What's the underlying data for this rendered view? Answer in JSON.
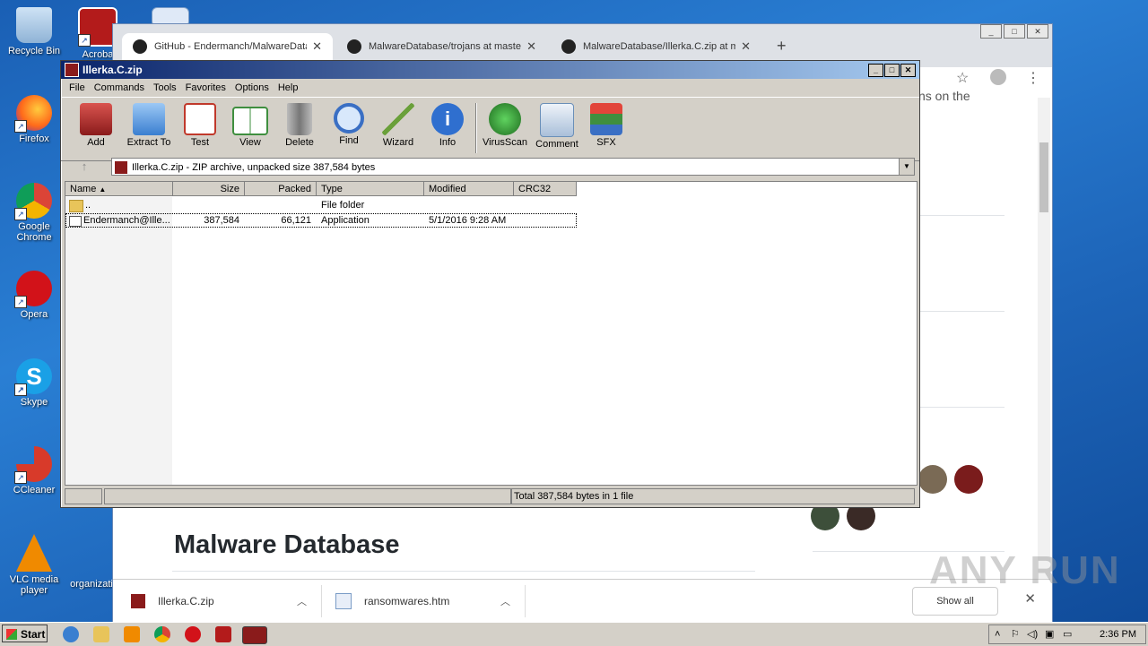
{
  "desktop": {
    "icons": [
      {
        "label": "Recycle Bin",
        "icon": "recycle-bin-icon"
      },
      {
        "label": "Firefox",
        "icon": "firefox-icon"
      },
      {
        "label": "Google Chrome",
        "icon": "chrome-icon"
      },
      {
        "label": "Opera",
        "icon": "opera-icon"
      },
      {
        "label": "Skype",
        "icon": "skype-icon"
      },
      {
        "label": "CCleaner",
        "icon": "ccleaner-icon"
      },
      {
        "label": "VLC media player",
        "icon": "vlc-icon"
      },
      {
        "label": "Acroba",
        "icon": "acrobat-icon"
      },
      {
        "label": "organizati",
        "icon": "word-doc-icon"
      }
    ]
  },
  "chrome": {
    "tabs": [
      {
        "title": "GitHub - Endermanch/MalwareDatab",
        "close": "✕"
      },
      {
        "title": "MalwareDatabase/trojans at master",
        "close": "✕"
      },
      {
        "title": "MalwareDatabase/Illerka.C.zip at ma",
        "close": "✕"
      }
    ],
    "new_tab": "+",
    "page_heading": "Malware Database",
    "right_snippet": "ns on the",
    "downloads": [
      {
        "name": "Illerka.C.zip",
        "icon": "winrar-icon"
      },
      {
        "name": "ransomwares.htm",
        "icon": "html-file-icon"
      }
    ],
    "show_all": "Show all"
  },
  "winrar": {
    "title": "Illerka.C.zip",
    "menu": [
      "File",
      "Commands",
      "Tools",
      "Favorites",
      "Options",
      "Help"
    ],
    "toolbar": [
      {
        "label": "Add",
        "icon": "add-archive-icon",
        "color": "#b5332e"
      },
      {
        "label": "Extract To",
        "icon": "extract-folder-icon",
        "color": "#4a8fd8"
      },
      {
        "label": "Test",
        "icon": "test-checklist-icon",
        "color": "#c0392b"
      },
      {
        "label": "View",
        "icon": "view-book-icon",
        "color": "#3f8f3f"
      },
      {
        "label": "Delete",
        "icon": "trash-can-icon",
        "color": "#8a8a8a"
      },
      {
        "label": "Find",
        "icon": "magnifier-icon",
        "color": "#3a6fc4"
      },
      {
        "label": "Wizard",
        "icon": "magic-wand-icon",
        "color": "#6aa03a"
      },
      {
        "label": "Info",
        "icon": "info-icon",
        "color": "#2f6fcf"
      },
      {
        "label": "VirusScan",
        "icon": "virus-scan-icon",
        "color": "#2e8b2e"
      },
      {
        "label": "Comment",
        "icon": "comment-icon",
        "color": "#6a8fb8"
      },
      {
        "label": "SFX",
        "icon": "sfx-archive-icon",
        "color": "#c76b2e"
      }
    ],
    "path": "Illerka.C.zip - ZIP archive, unpacked size 387,584 bytes",
    "columns": [
      "Name",
      "Size",
      "Packed",
      "Type",
      "Modified",
      "CRC32"
    ],
    "rows": [
      {
        "name": "..",
        "size": "",
        "packed": "",
        "type": "File folder",
        "modified": "",
        "crc": ""
      },
      {
        "name": "Endermanch@Ille...",
        "size": "387,584",
        "packed": "66,121",
        "type": "Application",
        "modified": "5/1/2016 9:28 AM",
        "crc": ""
      }
    ],
    "status_total": "Total 387,584 bytes in 1 file"
  },
  "taskbar": {
    "start": "Start",
    "clock": "2:36 PM"
  },
  "watermark": "ANY RUN"
}
